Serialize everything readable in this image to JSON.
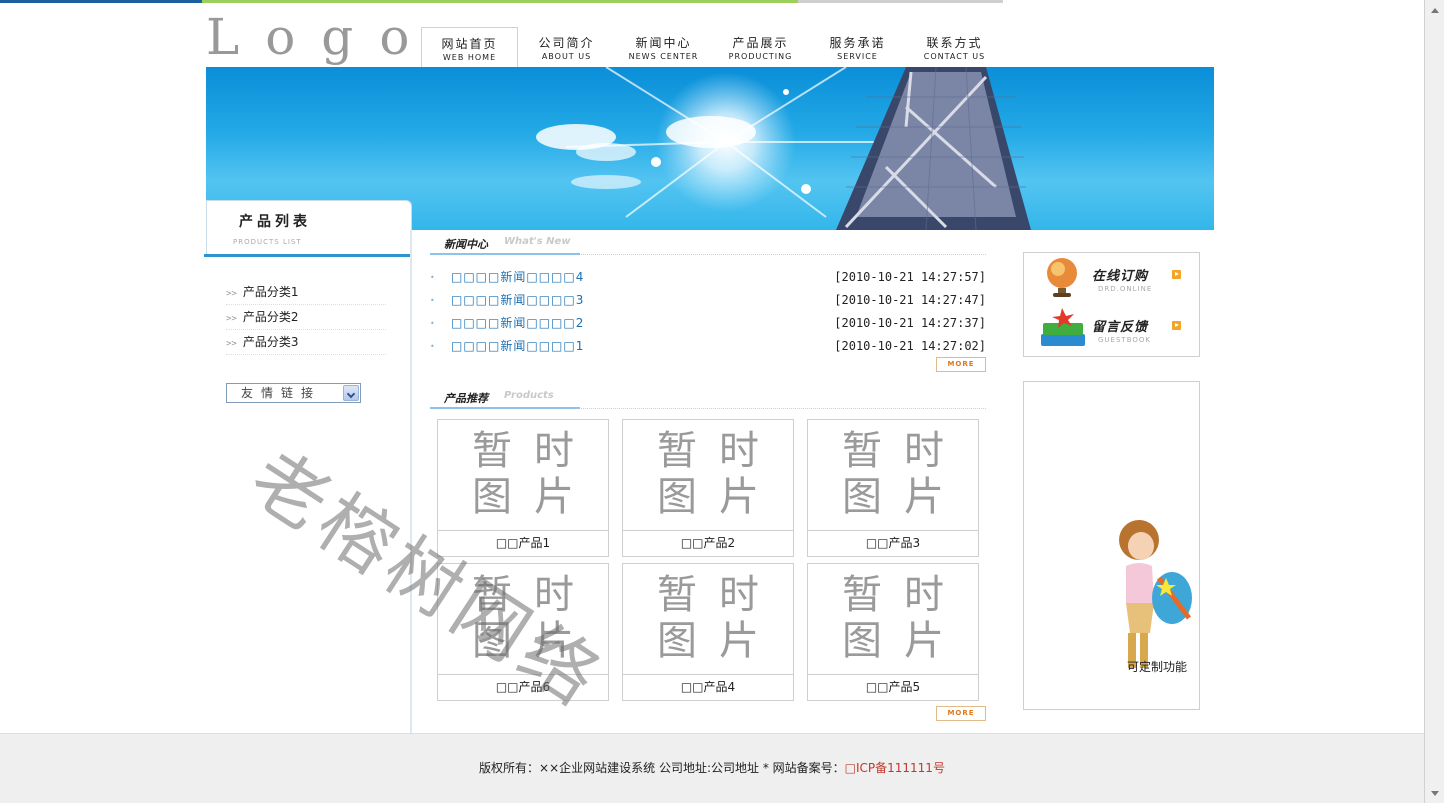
{
  "logo": {
    "text": "Logo"
  },
  "nav": [
    {
      "zh": "网站首页",
      "en": "WEB HOME",
      "active": true
    },
    {
      "zh": "公司简介",
      "en": "ABOUT US"
    },
    {
      "zh": "新闻中心",
      "en": "NEWS CENTER"
    },
    {
      "zh": "产品展示",
      "en": "PRODUCTING"
    },
    {
      "zh": "服务承诺",
      "en": "SERVICE"
    },
    {
      "zh": "联系方式",
      "en": "CONTACT US"
    }
  ],
  "sidebar": {
    "title": "产品列表",
    "subtitle": "PRODUCTS LIST",
    "categories": [
      "产品分类1",
      "产品分类2",
      "产品分类3"
    ],
    "category_bullet": ">>",
    "links_select": "友情链接"
  },
  "news": {
    "title_zh": "新闻中心",
    "title_en": "What's New",
    "items": [
      {
        "title": "□□□□新闻□□□□4",
        "date": "[2010-10-21 14:27:57]"
      },
      {
        "title": "□□□□新闻□□□□3",
        "date": "[2010-10-21 14:27:47]"
      },
      {
        "title": "□□□□新闻□□□□2",
        "date": "[2010-10-21 14:27:37]"
      },
      {
        "title": "□□□□新闻□□□□1",
        "date": "[2010-10-21 14:27:02]"
      }
    ],
    "more_label": "MORE"
  },
  "products": {
    "title_zh": "产品推荐",
    "title_en": "Products",
    "placeholder_line1": "暂时",
    "placeholder_line2": "图片",
    "items": [
      "□□产品1",
      "□□产品2",
      "□□产品3",
      "□□产品6",
      "□□产品4",
      "□□产品5"
    ],
    "more_label": "MORE"
  },
  "services": [
    {
      "title": "在线订购",
      "sub": "DRD.ONLINE",
      "icon": "globe-lamp-icon"
    },
    {
      "title": "留言反馈",
      "sub": "GUESTBOOK",
      "icon": "books-icon"
    }
  ],
  "custom_box": {
    "label": "可定制功能"
  },
  "watermark": "老榕树网络",
  "footer": {
    "text": "版权所有：××企业网站建设系统   公司地址:公司地址  *  网站备案号：",
    "icp": "□ICP备111111号"
  },
  "colors": {
    "accent_blue": "#2c94cf",
    "link_blue": "#1b6fb2",
    "more_orange": "#e07a1a",
    "icp_red": "#c0392b"
  }
}
